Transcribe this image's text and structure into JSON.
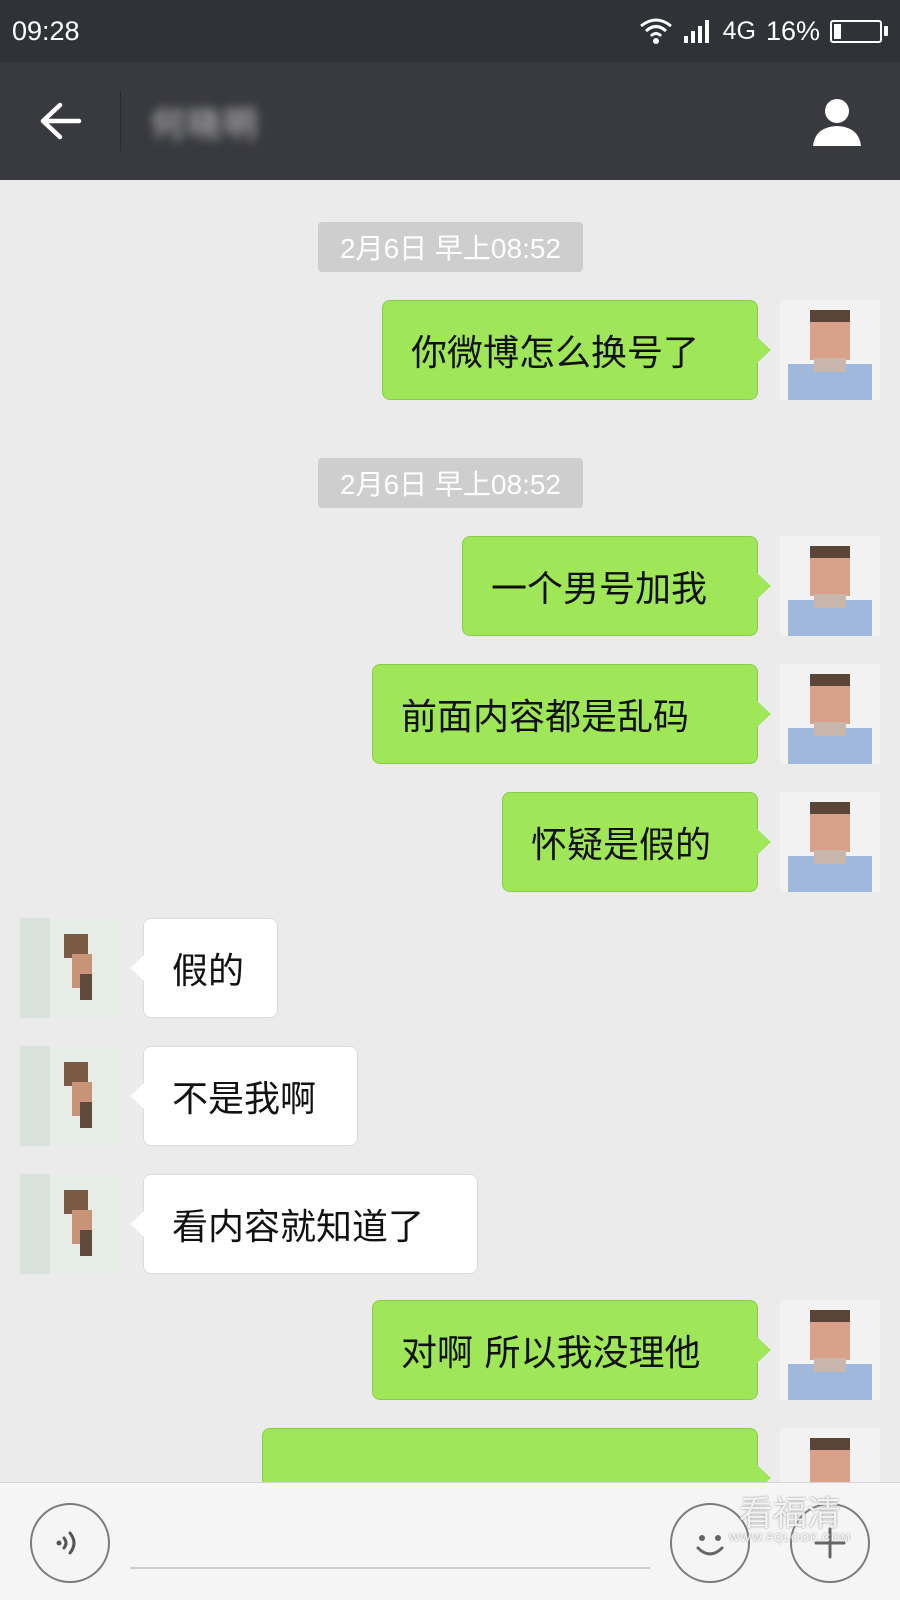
{
  "status_bar": {
    "time": "09:28",
    "network": "4G",
    "battery_percent": "16%",
    "battery_level": 0.16
  },
  "title_bar": {
    "contact_name": "何晓明"
  },
  "chat": {
    "timestamps": [
      "2月6日 早上08:52",
      "2月6日 早上08:52"
    ],
    "messages": [
      {
        "sender": "me",
        "text": "你微博怎么换号了"
      },
      {
        "sender": "me",
        "text": "一个男号加我"
      },
      {
        "sender": "me",
        "text": "前面内容都是乱码"
      },
      {
        "sender": "me",
        "text": "怀疑是假的"
      },
      {
        "sender": "other",
        "text": "假的"
      },
      {
        "sender": "other",
        "text": "不是我啊"
      },
      {
        "sender": "other",
        "text": "看内容就知道了"
      },
      {
        "sender": "me",
        "text": "对啊 所以我没理他"
      },
      {
        "sender": "me",
        "text": ""
      }
    ]
  },
  "input_bar": {
    "placeholder": "",
    "watermark": "看福清",
    "watermark_url": "WWW.FQLOOK.COM"
  },
  "colors": {
    "status_bg": "#2f3236",
    "title_bg": "#393a3f",
    "chat_bg": "#ebebeb",
    "my_bubble": "#9fe658",
    "other_bubble": "#ffffff"
  },
  "icons": [
    "back-arrow-icon",
    "wifi-icon",
    "signal-icon",
    "battery-icon",
    "contact-profile-icon",
    "voice-icon",
    "emoji-icon",
    "plus-icon"
  ]
}
